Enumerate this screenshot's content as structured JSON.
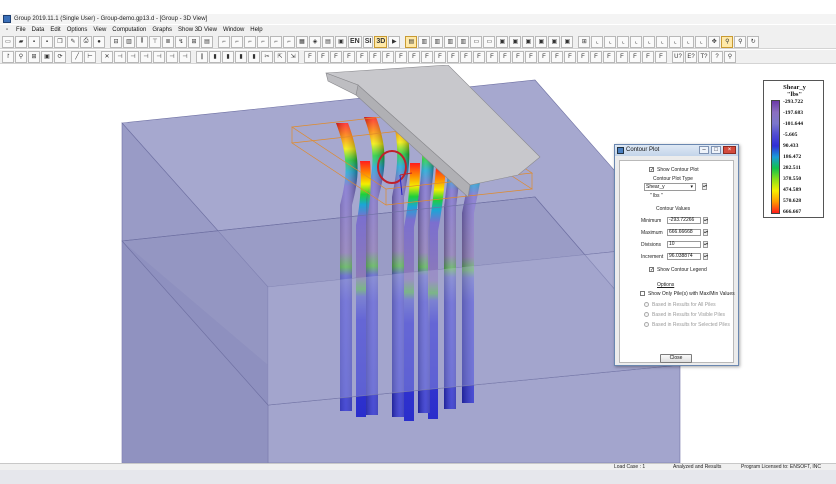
{
  "window": {
    "title": "Group 2019.11.1 (Single User) - Group-demo.gp13.d - [Group - 3D View]"
  },
  "menu": [
    "File",
    "Data",
    "Edit",
    "Options",
    "View",
    "Computation",
    "Graphs",
    "Show 3D View",
    "Window",
    "Help"
  ],
  "toolbar": {
    "en_label": "EN",
    "si_label": "SI",
    "view_3d_label": "3D"
  },
  "legend": {
    "title": "Shear_y",
    "unit": "\"lbs\"",
    "values": [
      "-293.722",
      "-197.683",
      "-101.644",
      "-5.605",
      "90.433",
      "186.472",
      "282.511",
      "378.550",
      "474.589",
      "570.628",
      "666.667"
    ]
  },
  "dialog": {
    "title": "Contour Plot",
    "show_contour_plot": "Show Contour Plot",
    "plot_type_header": "Contour Plot Type",
    "plot_type_value": "Shear_y",
    "plot_type_unit": "\" lbs \"",
    "values_header": "Contour Values",
    "minimum_label": "Minimum",
    "minimum_value": "-293.72266",
    "maximum_label": "Maximum",
    "maximum_value": "666.66668",
    "divisions_label": "Divisions",
    "divisions_value": "10",
    "increment_label": "Increment",
    "increment_value": "96.038874",
    "show_legend": "Show Contour Legend",
    "options_header": "Options",
    "show_only_piles": "Show Only Pile(s) with Max/Min Values",
    "radio_all": "Based in Results for All Piles",
    "radio_visible": "Based in Results for Visible Piles",
    "radio_selected": "Based in Results for Selected Piles",
    "close_label": "Close"
  },
  "status": {
    "load_case": "Load Case : 1",
    "results": "Analyzed and Results",
    "license": "Program Licensed to: ENSOFT, INC"
  },
  "colors": {
    "soil": "#9fa1c9",
    "pile_low": "#2a2ecc",
    "pile_high": "#ff2020",
    "cap": "#c8c8cc"
  }
}
